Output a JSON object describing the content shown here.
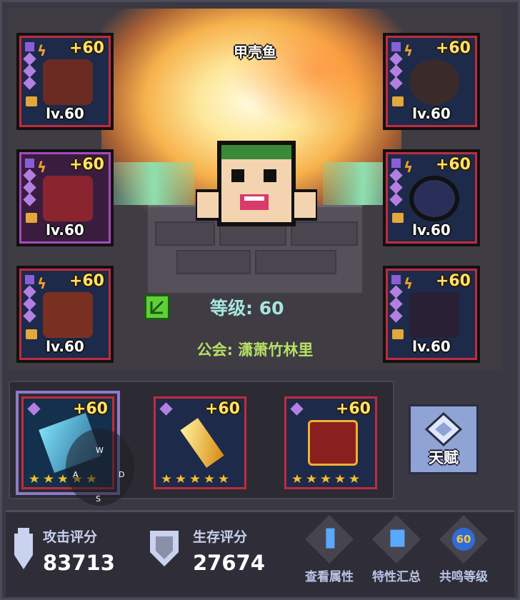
{
  "pet_name": "甲壳鱼",
  "level_text": "等级: 60",
  "guild_text": "公会: 潇萧竹林里",
  "equipment": [
    {
      "plus": "+60",
      "level": "lv.60"
    },
    {
      "plus": "+60",
      "level": "lv.60"
    },
    {
      "plus": "+60",
      "level": "lv.60"
    },
    {
      "plus": "+60",
      "level": "lv.60"
    },
    {
      "plus": "+60",
      "level": "lv.60"
    },
    {
      "plus": "+60",
      "level": "lv.60"
    }
  ],
  "weapons": [
    {
      "plus": "+60",
      "stars": 5
    },
    {
      "plus": "+60",
      "stars": 5
    },
    {
      "plus": "+60",
      "stars": 5
    }
  ],
  "talent_label": "天赋",
  "joystick": {
    "up": "W",
    "left": "A",
    "right": "D",
    "down": "S"
  },
  "footer": {
    "attack_label": "攻击评分",
    "attack_value": "83713",
    "survive_label": "生存评分",
    "survive_value": "27674",
    "buttons": [
      "查看属性",
      "特性汇总",
      "共鸣等级"
    ],
    "resonance_badge": "60"
  },
  "colors": {
    "accent_red": "#c12b3e",
    "accent_purple": "#a74abf",
    "plus_yellow": "#ffe36a",
    "level_teal": "#a5e6de",
    "guild_green": "#b6e062"
  }
}
